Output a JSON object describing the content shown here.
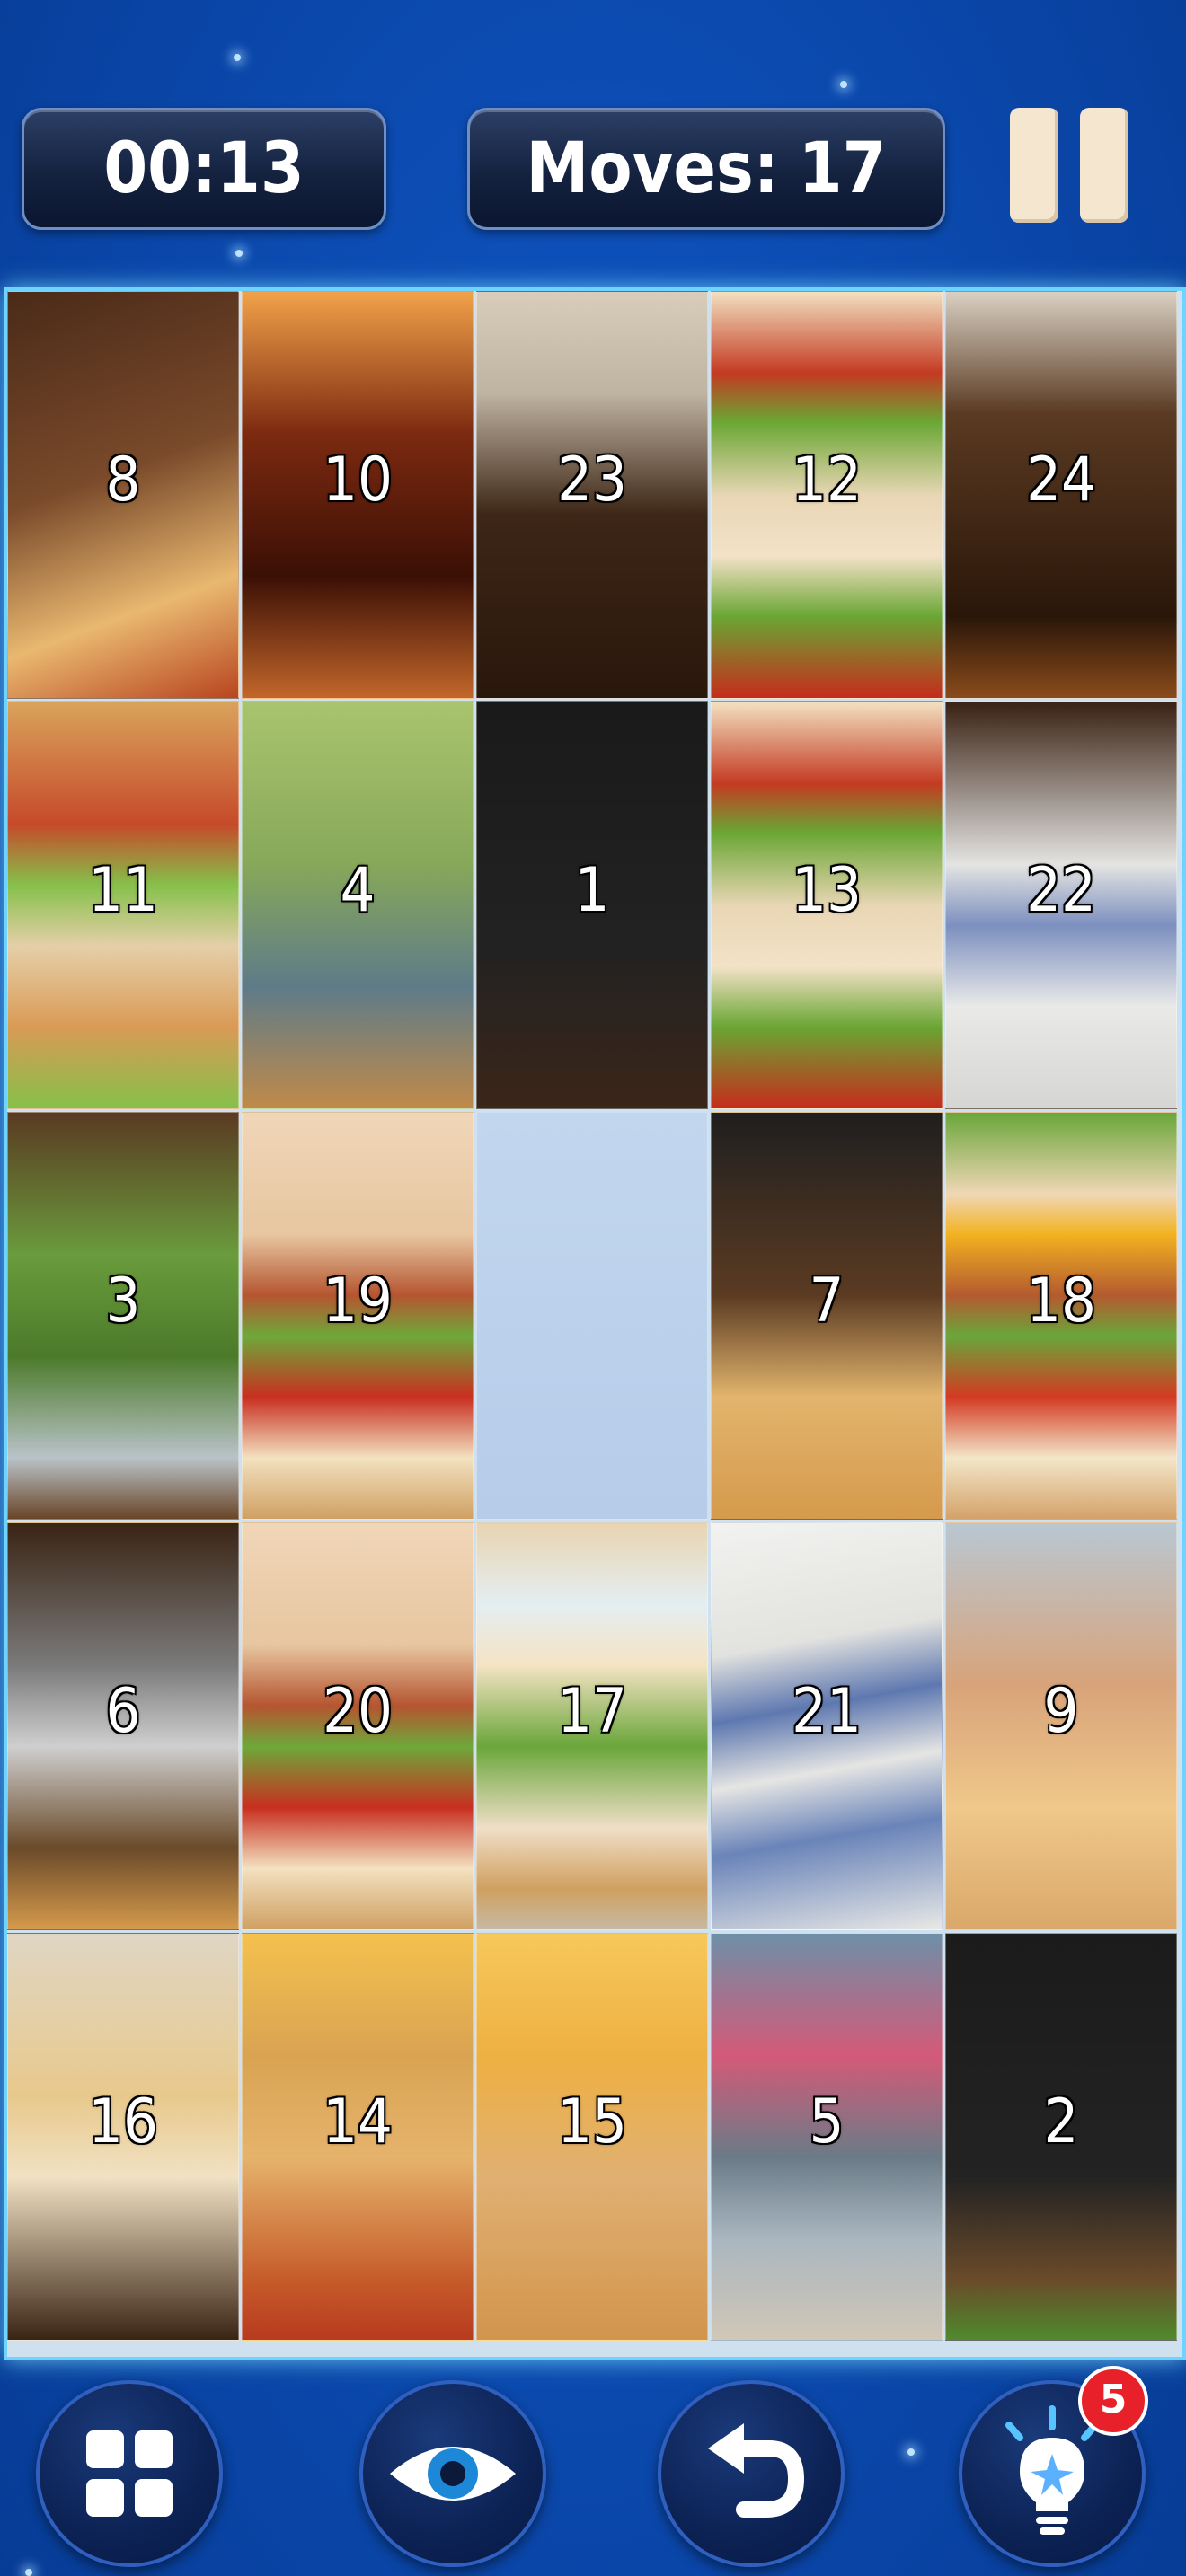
{
  "header": {
    "timer": "00:13",
    "moves_label": "Moves:",
    "moves_value": "17"
  },
  "board": {
    "rows": 5,
    "cols": 5,
    "empty_position": "row 3, column 3",
    "tiles": [
      [
        "8",
        "10",
        "23",
        "12",
        "24"
      ],
      [
        "11",
        "4",
        "1",
        "13",
        "22"
      ],
      [
        "3",
        "19",
        "",
        "7",
        "18"
      ],
      [
        "6",
        "20",
        "17",
        "21",
        "9"
      ],
      [
        "16",
        "14",
        "15",
        "5",
        "2"
      ]
    ]
  },
  "controls": [
    {
      "icon": "grid-icon"
    },
    {
      "icon": "eye-icon"
    },
    {
      "icon": "undo-icon"
    },
    {
      "icon": "lightbulb-hint-icon",
      "badge": "5"
    }
  ],
  "colors": {
    "background": "#0d4fb8",
    "board_border": "#6fd3ff",
    "badge": "#e8202a",
    "pause": "#f5e6cf"
  }
}
